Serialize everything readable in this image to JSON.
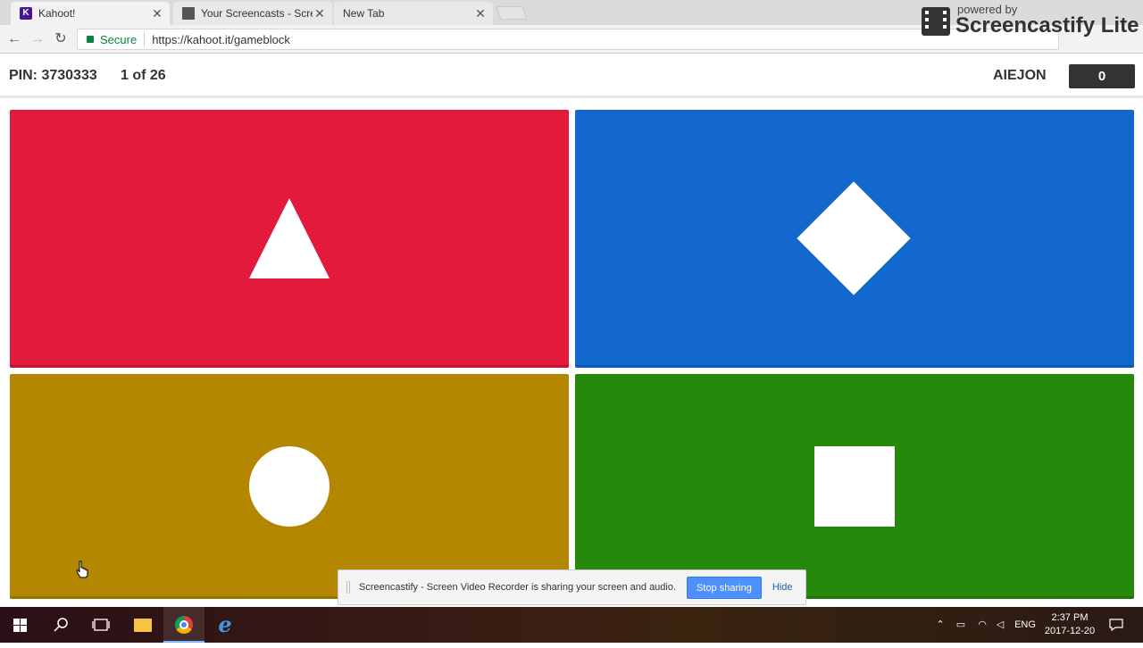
{
  "browser": {
    "tabs": [
      {
        "label": "Kahoot!",
        "icon": "kahoot-favicon",
        "active": true
      },
      {
        "label": "Your Screencasts - Scree",
        "icon": "screencastify-favicon",
        "active": false
      },
      {
        "label": "New Tab",
        "icon": "",
        "active": false
      }
    ],
    "close_glyph": "✕",
    "secure_label": "Secure",
    "url": "https://kahoot.it/gameblock"
  },
  "watermark": {
    "powered_by": "powered by",
    "name": "Screencastify Lite"
  },
  "game": {
    "pin": "PIN: 3730333",
    "question_count": "1 of 26",
    "nickname": "AIEJON",
    "score": "0",
    "answers": [
      {
        "shape": "triangle",
        "color": "#e21b3c"
      },
      {
        "shape": "diamond",
        "color": "#1368ce"
      },
      {
        "shape": "circle",
        "color": "#b38800"
      },
      {
        "shape": "square",
        "color": "#26890c"
      }
    ]
  },
  "sharing_bar": {
    "message": "Screencastify - Screen Video Recorder is sharing your screen and audio.",
    "stop_label": "Stop sharing",
    "hide_label": "Hide"
  },
  "taskbar": {
    "language": "ENG",
    "time": "2:37 PM",
    "date": "2017-12-20"
  }
}
